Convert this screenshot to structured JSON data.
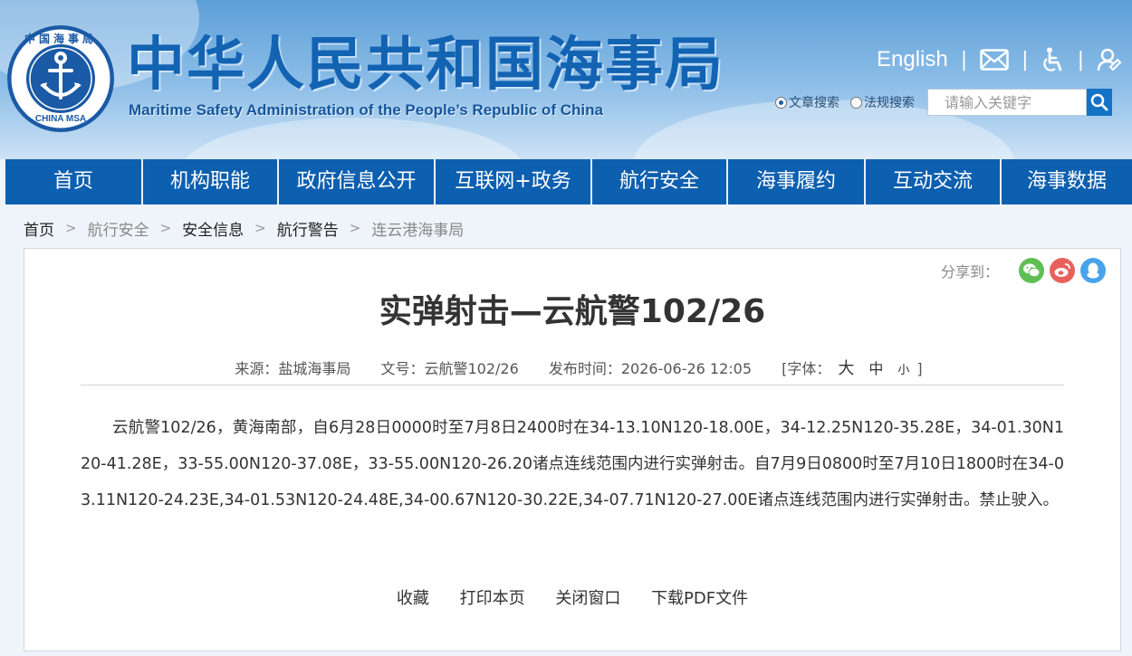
{
  "header": {
    "title": "中华人民共和国海事局",
    "subtitle": "Maritime Safety Administration of the People’s Republic of China",
    "emblem_text": "中国海事局",
    "emblem_text_en": "CHINA MSA",
    "english_link": "English",
    "mail_icon": "mail-icon",
    "accessibility_icon": "accessibility-icon",
    "user_icon": "user-icon"
  },
  "search": {
    "option_article": "文章搜索",
    "option_law": "法规搜索",
    "selected": "文章搜索",
    "placeholder": "请输入关键字",
    "icon": "search-icon"
  },
  "nav": {
    "items": [
      {
        "label": "首页"
      },
      {
        "label": "机构职能"
      },
      {
        "label": "政府信息公开"
      },
      {
        "label": "互联网+政务"
      },
      {
        "label": "航行安全"
      },
      {
        "label": "海事履约"
      },
      {
        "label": "互动交流"
      },
      {
        "label": "海事数据"
      }
    ]
  },
  "breadcrumb": {
    "items": [
      "首页",
      "航行安全",
      "安全信息",
      "航行警告",
      "连云港海事局"
    ]
  },
  "article": {
    "share_label": "分享到：",
    "share_icons": [
      "wechat-icon",
      "weibo-icon",
      "qq-icon"
    ],
    "title": "实弹射击—云航警102/26",
    "source": "来源：盐城海事局",
    "doc_no": "文号：云航警102/26",
    "publish_time": "发布时间：2026-06-26 12:05",
    "font_label": "[字体：",
    "font_large": "大",
    "font_medium": "中",
    "font_small": "小",
    "font_close": "]",
    "body": "云航警102/26，黄海南部，自6月28日0000时至7月8日2400时在34-13.10N120-18.00E，34-12.25N120-35.28E，34-01.30N120-41.28E，33-55.00N120-37.08E，33-55.00N120-26.20诸点连线范围内进行实弹射击。自7月9日0800时至7月10日1800时在34-03.11N120-24.23E,34-01.53N120-24.48E,34-00.67N120-30.22E,34-07.71N120-27.00E诸点连线范围内进行实弹射击。禁止驶入。",
    "actions": {
      "favorite": "收藏",
      "print": "打印本页",
      "close": "关闭窗口",
      "pdf": "下载PDF文件"
    }
  },
  "colors": {
    "nav_bg": "#0d5faf",
    "title_blue": "#1363b3",
    "wechat": "#5fbf55",
    "weibo": "#e8625b",
    "qq": "#4aa3ea"
  }
}
